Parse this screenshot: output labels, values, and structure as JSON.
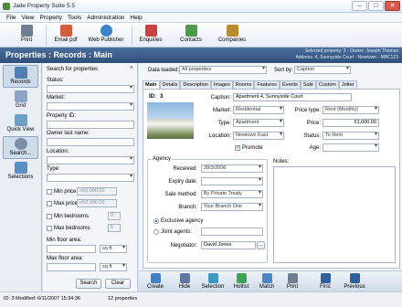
{
  "window": {
    "title": "Jade Property Suite 5.5",
    "minimize": "–",
    "maximize": "□",
    "close": "✕"
  },
  "menu": [
    "File",
    "View",
    "Property",
    "Tools",
    "Administration",
    "Help"
  ],
  "toolbar": {
    "print": "Print",
    "email_pdf": "Email pdf",
    "web_publisher": "Web Publisher",
    "enquiries": "Enquiries",
    "contacts": "Contacts",
    "companies": "Companies"
  },
  "header": {
    "title": "Properties : Records : Main",
    "selected_line1": "Selected property: 3 - Owner: Joseph Thomas",
    "selected_line2": "Address: 4, Sunnyside Court - Newtown - MBC123"
  },
  "nav": {
    "records": "Records",
    "grid": "Grid",
    "quick_view": "Quick View",
    "search": "Search...",
    "selections": "Selections"
  },
  "search_panel": {
    "title": "Search for properties",
    "close": "×",
    "status_label": "Status:",
    "market_label": "Market:",
    "property_id_label": "Property ID:",
    "owner_last_name_label": "Owner last name:",
    "location_label": "Location:",
    "type_label": "Type:",
    "min_price_label": "Min price",
    "min_price_value": "¤50,000.00",
    "max_price_label": "Max price",
    "max_price_value": "¤50,000.00",
    "min_bedrooms_label": "Min bedrooms",
    "min_bedrooms_value": "0",
    "max_bedrooms_label": "Max bedrooms",
    "max_bedrooms_value": "5",
    "min_floor_area_label": "Min floor area:",
    "min_floor_unit": "sq ft",
    "max_floor_area_label": "Max floor area:",
    "max_floor_unit": "sq ft",
    "search_button": "Search",
    "clear_button": "Clear"
  },
  "main": {
    "data_loaded_label": "Data loaded:",
    "data_loaded_value": "All properties",
    "sort_by_label": "Sort by:",
    "sort_by_value": "Caption",
    "tabs": [
      "Main",
      "Details",
      "Description",
      "Images",
      "Rooms",
      "Features",
      "Events",
      "Sale",
      "Custom",
      "Jotter"
    ],
    "id_label": "ID:",
    "id_value": "3",
    "caption_label": "Caption:",
    "caption_value": "Apartment 4, Sunnyside Court",
    "market_label": "Market:",
    "market_value": "Residential",
    "type_label": "Type:",
    "type_value": "Apartment",
    "location_label": "Location:",
    "location_value": "Newtown East",
    "promote_label": "Promote",
    "price_type_label": "Price type:",
    "price_type_value": "Rent (Monthly)",
    "price_label": "Price:",
    "price_value": "€1,000.00",
    "status_label": "Status:",
    "status_value": "To Rent",
    "age_label": "Age:",
    "agency_title": "Agency",
    "received_label": "Received:",
    "received_value": "28/3/2006",
    "expiry_label": "Expiry date:",
    "sale_method_label": "Sale method:",
    "sale_method_value": "By Private Treaty",
    "branch_label": "Branch:",
    "branch_value": "Your Branch One",
    "exclusive_agency_label": "Exclusive agency",
    "joint_agents_label": "Joint agents:",
    "negotiator_label": "Negotiator:",
    "negotiator_value": "David Jones",
    "notes_label": "Notes:"
  },
  "bottom_toolbar": {
    "create": "Create",
    "hide": "Hide",
    "selection": "Selection",
    "hotlist": "Hotlist",
    "match": "Match",
    "print": "Print",
    "first": "First",
    "previous": "Previous"
  },
  "status": {
    "record": "ID: 3 Modified: 6/11/2007 15:34:36",
    "count": "12 properties"
  },
  "colors": {
    "header": "#2f4f7a",
    "accent": "#1d4f9a"
  }
}
